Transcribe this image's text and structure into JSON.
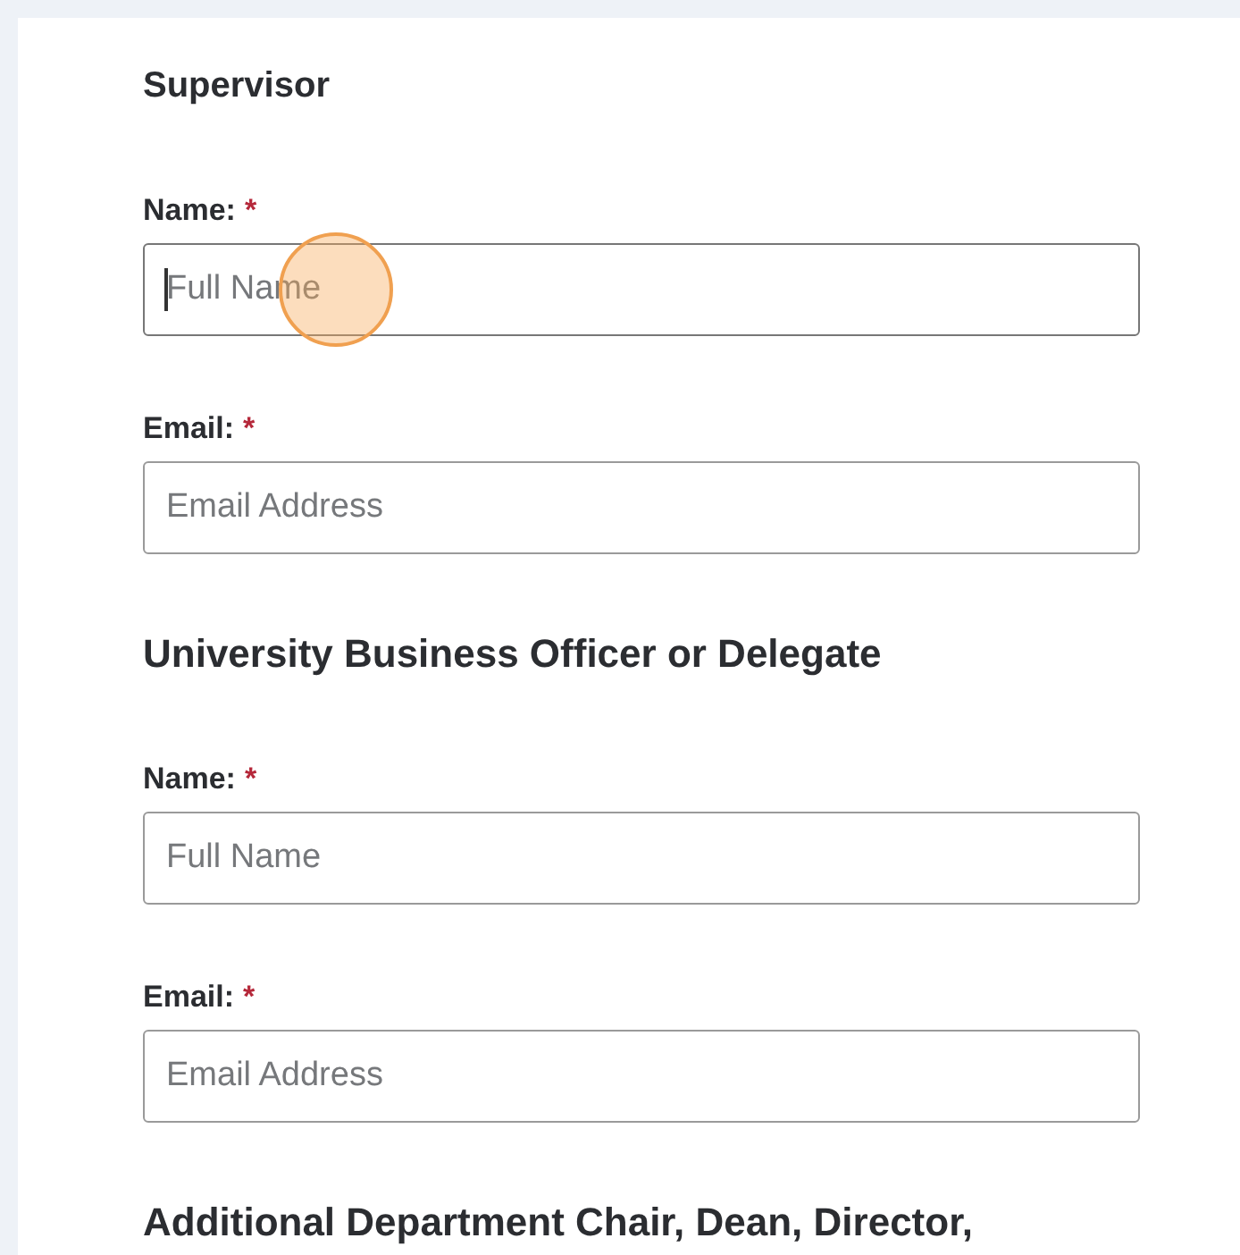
{
  "sections": [
    {
      "heading": "Supervisor",
      "fields": [
        {
          "label": "Name:",
          "required_mark": "*",
          "placeholder": "Full Name",
          "focused": true
        },
        {
          "label": "Email:",
          "required_mark": "*",
          "placeholder": "Email Address",
          "focused": false
        }
      ]
    },
    {
      "heading": "University Business Officer or Delegate",
      "fields": [
        {
          "label": "Name:",
          "required_mark": "*",
          "placeholder": "Full Name",
          "focused": false
        },
        {
          "label": "Email:",
          "required_mark": "*",
          "placeholder": "Email Address",
          "focused": false
        }
      ]
    },
    {
      "heading": "Additional Department Chair, Dean, Director,"
    }
  ]
}
